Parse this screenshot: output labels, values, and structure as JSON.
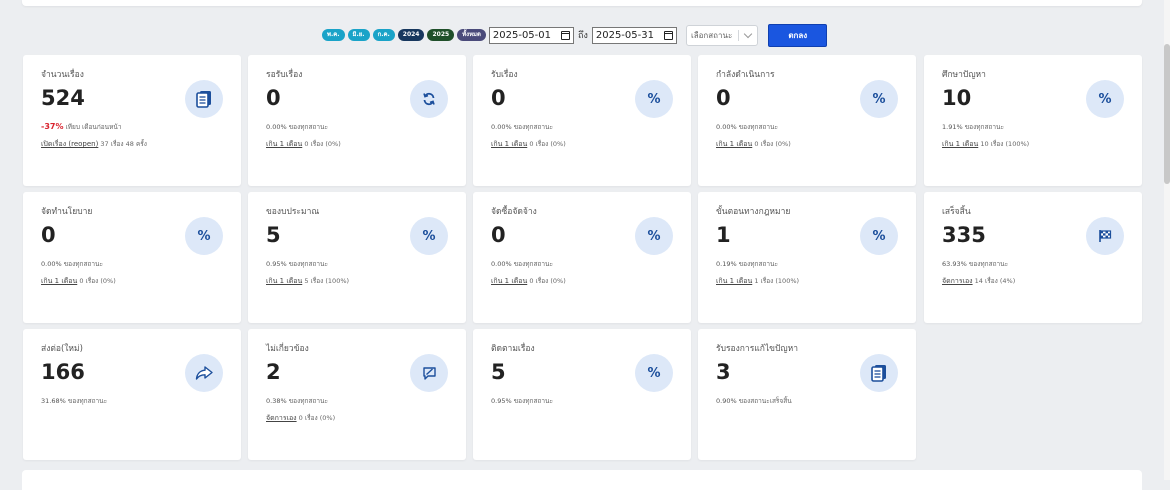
{
  "filter": {
    "pills": [
      {
        "label": "พ.ค.",
        "color": "#1aa3c8"
      },
      {
        "label": "มิ.ย.",
        "color": "#1aa3c8"
      },
      {
        "label": "ก.ค.",
        "color": "#1aa3c8"
      },
      {
        "label": "2024",
        "color": "#17375e"
      },
      {
        "label": "2025",
        "color": "#1f4f2a"
      },
      {
        "label": "ทั้งหมด",
        "color": "#4a4a7a"
      }
    ],
    "date_from": "2025-05-01",
    "to_label": "ถึง",
    "date_to": "2025-05-31",
    "status_placeholder": "เลือกสถานะ",
    "ok_label": "ตกลง"
  },
  "cards": [
    {
      "title": "จำนวนเรื่อง",
      "value": "524",
      "note_neg": "-37%",
      "note": "เทียบ เดือนก่อนหน้า",
      "sub_link": "เปิดเรื่อง (reopen)",
      "sub_text": "37 เรื่อง 48 ครั้ง",
      "icon": "document-stack-icon"
    },
    {
      "title": "รอรับเรื่อง",
      "value": "0",
      "note_pct": "0.00%",
      "note": "ของทุกสถานะ",
      "sub_link": "เกิน 1 เดือน",
      "sub_text": "0 เรื่อง (0%)",
      "icon": "refresh-icon"
    },
    {
      "title": "รับเรื่อง",
      "value": "0",
      "note_pct": "0.00%",
      "note": "ของทุกสถานะ",
      "sub_link": "เกิน 1 เดือน",
      "sub_text": "0 เรื่อง (0%)",
      "icon": "percent-icon"
    },
    {
      "title": "กำลังดำเนินการ",
      "value": "0",
      "note_pct": "0.00%",
      "note": "ของทุกสถานะ",
      "sub_link": "เกิน 1 เดือน",
      "sub_text": "0 เรื่อง (0%)",
      "icon": "percent-icon"
    },
    {
      "title": "ศึกษาปัญหา",
      "value": "10",
      "note_pct": "1.91%",
      "note": "ของทุกสถานะ",
      "sub_link": "เกิน 1 เดือน",
      "sub_text": "10 เรื่อง (100%)",
      "icon": "percent-icon"
    },
    {
      "title": "จัดทำนโยบาย",
      "value": "0",
      "note_pct": "0.00%",
      "note": "ของทุกสถานะ",
      "sub_link": "เกิน 1 เดือน",
      "sub_text": "0 เรื่อง (0%)",
      "icon": "percent-icon"
    },
    {
      "title": "ของบประมาณ",
      "value": "5",
      "note_pct": "0.95%",
      "note": "ของทุกสถานะ",
      "sub_link": "เกิน 1 เดือน",
      "sub_text": "5 เรื่อง (100%)",
      "icon": "percent-icon"
    },
    {
      "title": "จัดซื้อจัดจ้าง",
      "value": "0",
      "note_pct": "0.00%",
      "note": "ของทุกสถานะ",
      "sub_link": "เกิน 1 เดือน",
      "sub_text": "0 เรื่อง (0%)",
      "icon": "percent-icon"
    },
    {
      "title": "ขั้นตอนทางกฎหมาย",
      "value": "1",
      "note_pct": "0.19%",
      "note": "ของทุกสถานะ",
      "sub_link": "เกิน 1 เดือน",
      "sub_text": "1 เรื่อง (100%)",
      "icon": "percent-icon"
    },
    {
      "title": "เสร็จสิ้น",
      "value": "335",
      "note_pct": "63.93%",
      "note": "ของทุกสถานะ",
      "sub_link": "จัดการเอง",
      "sub_text": "14 เรื่อง (4%)",
      "icon": "checkered-flag-icon"
    },
    {
      "title": "ส่งต่อ(ใหม่)",
      "value": "166",
      "note_pct": "31.68%",
      "note": "ของทุกสถานะ",
      "sub_link": "",
      "sub_text": "",
      "icon": "share-forward-icon"
    },
    {
      "title": "ไม่เกี่ยวข้อง",
      "value": "2",
      "note_pct": "0.38%",
      "note": "ของทุกสถานะ",
      "sub_link": "จัดการเอง",
      "sub_text": "0 เรื่อง (0%)",
      "icon": "message-slash-icon"
    },
    {
      "title": "ติดตามเรื่อง",
      "value": "5",
      "note_pct": "0.95%",
      "note": "ของทุกสถานะ",
      "sub_link": "",
      "sub_text": "",
      "icon": "percent-icon"
    },
    {
      "title": "รับรองการแก้ไขปัญหา",
      "value": "3",
      "note_pct": "0.90%",
      "note": "ของสถานะเสร็จสิ้น",
      "sub_link": "",
      "sub_text": "",
      "icon": "document-stack-icon"
    }
  ],
  "colors": {
    "accent": "#1a56e0",
    "icon_bg": "#dde8f8",
    "icon_fg": "#1c4f9c",
    "negative": "#d9232e"
  }
}
